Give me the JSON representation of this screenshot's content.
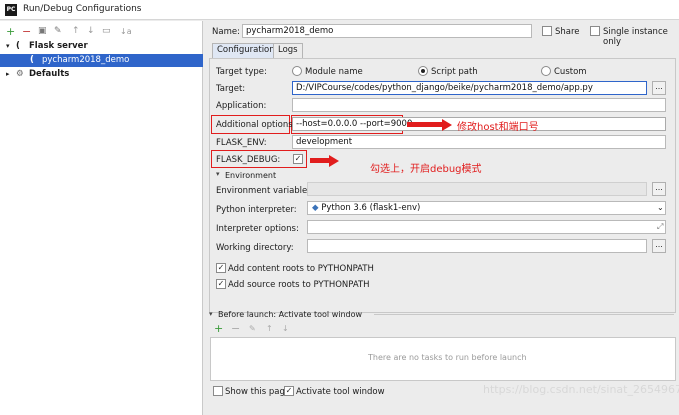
{
  "window": {
    "icon_text": "PC",
    "title": "Run/Debug Configurations"
  },
  "left_toolbar": [
    "+",
    "−",
    "▣",
    "✎",
    "↑",
    "↓",
    "▭",
    "↓a"
  ],
  "tree": {
    "group": "Flask server",
    "selected": "pycharm2018_demo",
    "defaults": "Defaults"
  },
  "name": {
    "label": "Name:",
    "value": "pycharm2018_demo"
  },
  "share": {
    "label": "Share",
    "checked": false
  },
  "single_instance": {
    "label": "Single instance only",
    "checked": false
  },
  "tabs": [
    "Configuration",
    "Logs"
  ],
  "target_type": {
    "label": "Target type:",
    "options": [
      "Module name",
      "Script path",
      "Custom"
    ],
    "selected": "Script path"
  },
  "target": {
    "label": "Target:",
    "value": "D:/VIPCourse/codes/python_django/beike/pycharm2018_demo/app.py"
  },
  "application": {
    "label": "Application:",
    "value": ""
  },
  "additional_options": {
    "label": "Additional options:",
    "value": "--host=0.0.0.0 --port=9000"
  },
  "flask_env": {
    "label": "FLASK_ENV:",
    "value": "development"
  },
  "flask_debug": {
    "label": "FLASK_DEBUG:",
    "checked": true
  },
  "environment": {
    "section": "Environment",
    "env_vars_label": "Environment variables:",
    "interpreter_label": "Python interpreter:",
    "interpreter_value": "Python 3.6 (flask1-env)",
    "interpreter_options_label": "Interpreter options:",
    "working_dir_label": "Working directory:"
  },
  "content_roots": {
    "label": "Add content roots to PYTHONPATH",
    "checked": true
  },
  "source_roots": {
    "label": "Add source roots to PYTHONPATH",
    "checked": true
  },
  "before_launch": {
    "title": "Before launch: Activate tool window",
    "empty_text": "There are no tasks to run before launch"
  },
  "bottom": {
    "show_page": "Show this page",
    "activate_tool": "Activate tool window"
  },
  "annotations": {
    "host_port": "修改host和端口号",
    "debug": "勾选上，开启debug模式"
  },
  "watermark": "https://blog.csdn.net/sinat_26549677",
  "colors": {
    "annotation": "#e11d1d",
    "selection": "#2f65ca"
  }
}
